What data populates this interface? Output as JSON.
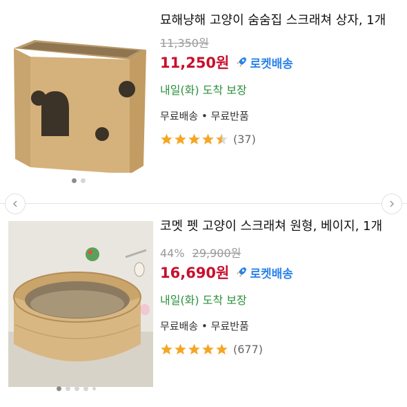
{
  "products": [
    {
      "title": "묘해냥해 고양이 숨숨집 스크래쳐 상자, 1개",
      "discount_percent": "",
      "original_price": "11,350원",
      "sale_price": "11,250원",
      "rocket_label": "로켓배송",
      "delivery": "내일(화) 도착 보장",
      "shipping": "무료배송 • 무료반품",
      "rating": 4.5,
      "review_count": "(37)",
      "image_dots": 2,
      "active_dot": 0
    },
    {
      "title": "코멧 펫 고양이 스크래쳐 원형, 베이지, 1개",
      "discount_percent": "44%",
      "original_price": "29,900원",
      "sale_price": "16,690원",
      "rocket_label": "로켓배송",
      "delivery": "내일(화) 도착 보장",
      "shipping": "무료배송 • 무료반품",
      "rating": 5,
      "review_count": "(677)",
      "image_dots": 5,
      "active_dot": 0
    }
  ],
  "colors": {
    "price": "#c8102e",
    "rocket": "#2b83e8",
    "delivery": "#2a8f3b",
    "star": "#f5a623"
  },
  "icons": {
    "rocket": "rocket-icon",
    "star": "star-icon",
    "prev": "chevron-left-icon",
    "next": "chevron-right-icon"
  }
}
